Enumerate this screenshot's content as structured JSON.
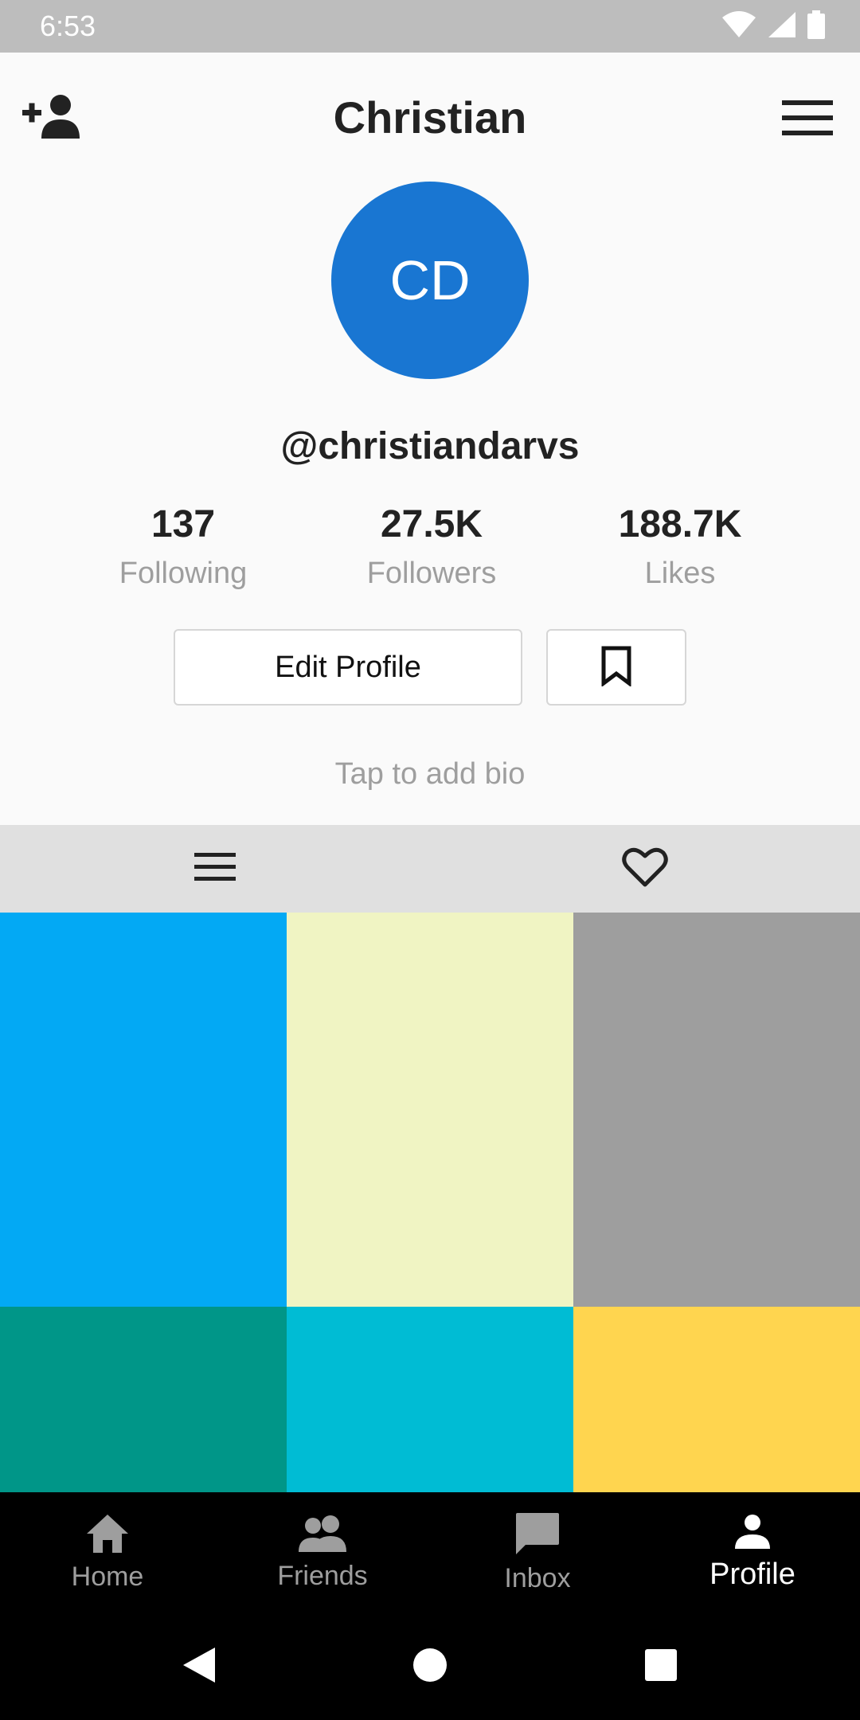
{
  "status_bar": {
    "time": "6:53",
    "icons": [
      "wifi-icon",
      "signal-icon",
      "battery-icon"
    ]
  },
  "header": {
    "title": "Christian",
    "left_icon": "add-person-icon",
    "right_icon": "menu-icon"
  },
  "profile": {
    "avatar_initials": "CD",
    "avatar_color": "#1976d2",
    "username": "@christiandarvs",
    "stats": {
      "following": {
        "value": "137",
        "label": "Following"
      },
      "followers": {
        "value": "27.5K",
        "label": "Followers"
      },
      "likes": {
        "value": "188.7K",
        "label": "Likes"
      }
    },
    "edit_button_label": "Edit Profile",
    "bookmark_icon": "bookmark-icon",
    "bio_prompt": "Tap to add bio"
  },
  "content_tabs": [
    {
      "icon": "list-icon",
      "selected": true
    },
    {
      "icon": "heart-icon",
      "selected": false
    }
  ],
  "grid_tiles": [
    {
      "color": "#03a9f4"
    },
    {
      "color": "#f0f4c3"
    },
    {
      "color": "#9e9e9e"
    },
    {
      "color": "#009688"
    },
    {
      "color": "#00bcd4"
    },
    {
      "color": "#ffd54f"
    }
  ],
  "bottom_nav": {
    "items": [
      {
        "label": "Home",
        "icon": "home-icon",
        "active": false
      },
      {
        "label": "Friends",
        "icon": "friends-icon",
        "active": false
      },
      {
        "label": "Inbox",
        "icon": "inbox-icon",
        "active": false
      },
      {
        "label": "Profile",
        "icon": "profile-icon",
        "active": true
      }
    ]
  },
  "system_nav": [
    "back-icon",
    "home-circle-icon",
    "recents-icon"
  ]
}
